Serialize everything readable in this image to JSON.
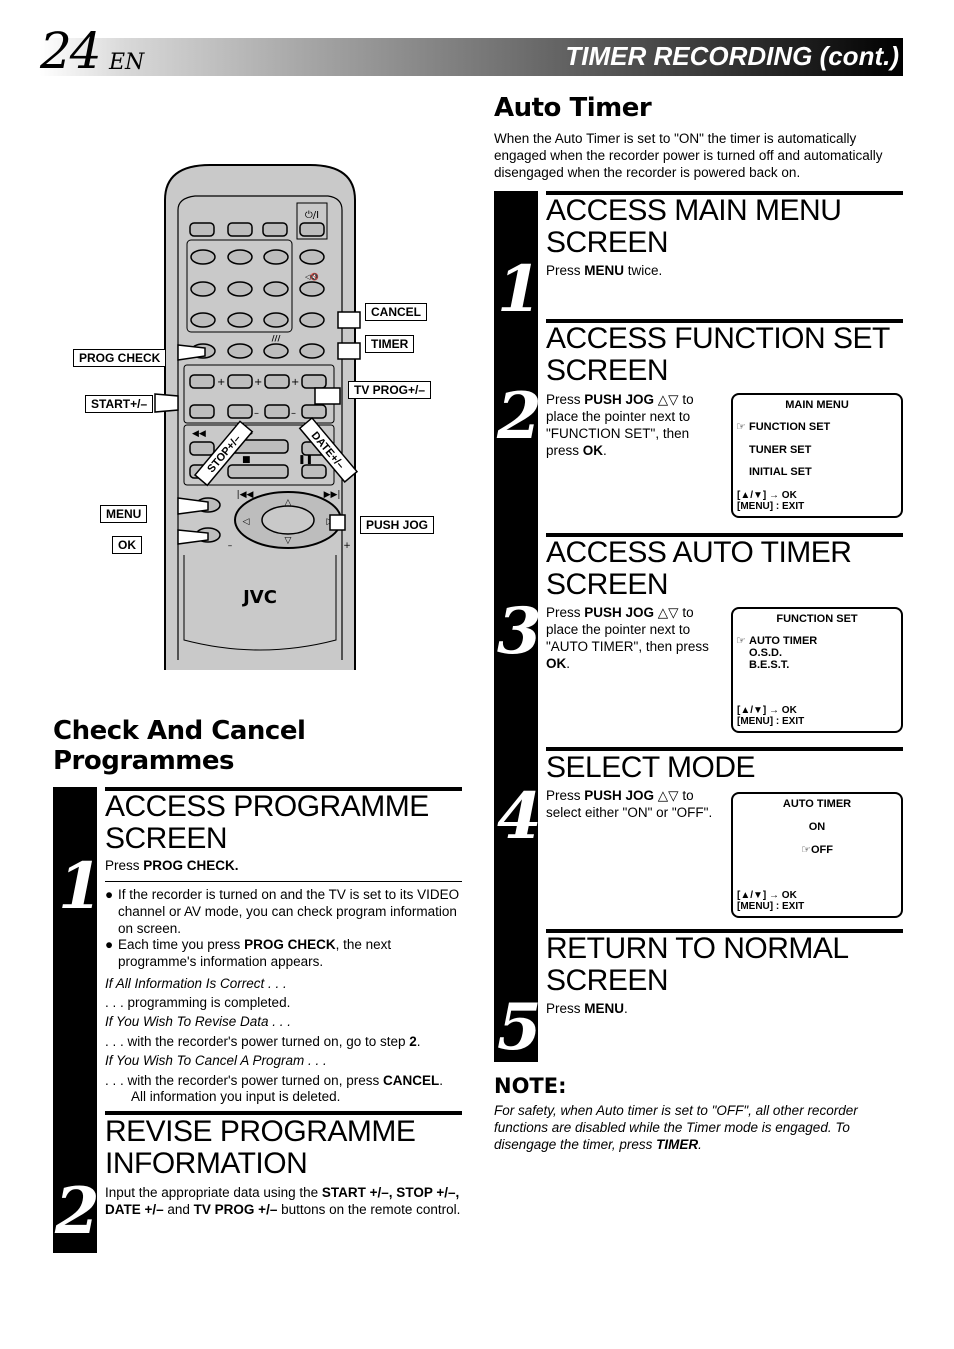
{
  "header": {
    "page_number": "24",
    "language": "EN",
    "title": "TIMER RECORDING (cont.)"
  },
  "remote": {
    "brand": "JVC",
    "callouts": {
      "cancel": "CANCEL",
      "timer": "TIMER",
      "prog_check": "PROG CHECK",
      "tv_prog": "TV PROG+/–",
      "start": "START+/–",
      "stop": "STOP+/–",
      "date": "DATE+/–",
      "menu": "MENU",
      "ok": "OK",
      "push_jog": "PUSH JOG"
    },
    "glyphs": {
      "power": "⏻/I",
      "plus": "+",
      "minus": "–"
    }
  },
  "check_cancel": {
    "heading_line1": "Check And Cancel",
    "heading_line2": "Programmes",
    "steps": [
      {
        "number": "1",
        "title_line1": "ACCESS PROGRAMME",
        "title_line2": "SCREEN",
        "instruction_prefix": "Press ",
        "instruction_bold": "PROG CHECK.",
        "bullets": [
          {
            "text": "If the recorder is turned on and the TV is set to its VIDEO channel or AV mode, you can check program information on screen."
          },
          {
            "pre": "Each time you press ",
            "bold": "PROG CHECK",
            "post": ", the next programme's information appears."
          }
        ],
        "cases": [
          {
            "condition": "If All Information Is Correct . . .",
            "result_pre": ". . . programming is completed.",
            "result_bold": "",
            "result_post": ""
          },
          {
            "condition": "If You Wish To Revise Data . . .",
            "result_pre": ". . . with the recorder's power turned on, go to step ",
            "result_bold": "2",
            "result_post": "."
          },
          {
            "condition": "If You Wish To Cancel A Program . . .",
            "result_pre": ". . . with the recorder's power turned on, press ",
            "result_bold": "CANCEL",
            "result_post": ".",
            "result_line2": "All information you input is deleted."
          }
        ]
      },
      {
        "number": "2",
        "title_line1": "REVISE PROGRAMME",
        "title_line2": "INFORMATION",
        "text_parts": [
          {
            "t": "Input the appropriate data using the ",
            "b": false
          },
          {
            "t": "START +/–, STOP +/–, DATE +/–",
            "b": true
          },
          {
            "t": " and ",
            "b": false
          },
          {
            "t": "TV PROG +/–",
            "b": true
          },
          {
            "t": " buttons on the remote control.",
            "b": false
          }
        ]
      }
    ]
  },
  "auto_timer": {
    "heading": "Auto Timer",
    "intro": "When the Auto Timer is set to \"ON\" the timer is automatically engaged when the recorder power is turned off and automatically disengaged when the recorder is powered back on.",
    "steps": [
      {
        "number": "1",
        "title_line1": "ACCESS MAIN MENU",
        "title_line2": "SCREEN",
        "parts": [
          {
            "t": "Press ",
            "b": false
          },
          {
            "t": "MENU",
            "b": true
          },
          {
            "t": " twice.",
            "b": false
          }
        ]
      },
      {
        "number": "2",
        "title_line1": "ACCESS FUNCTION SET",
        "title_line2": "SCREEN",
        "parts": [
          {
            "t": "Press ",
            "b": false
          },
          {
            "t": "PUSH JOG",
            "b": true
          },
          {
            "t": " △▽ to place the pointer next to \"FUNCTION SET\", then press ",
            "b": false
          },
          {
            "t": "OK",
            "b": true
          },
          {
            "t": ".",
            "b": false
          }
        ],
        "osd": {
          "title": "MAIN MENU",
          "items": [
            "FUNCTION SET",
            "TUNER SET",
            "INITIAL SET"
          ],
          "selected": "FUNCTION SET",
          "footer1": "[▲/▼] → OK",
          "footer2": "[MENU] : EXIT"
        }
      },
      {
        "number": "3",
        "title_line1": "ACCESS AUTO TIMER",
        "title_line2": "SCREEN",
        "parts": [
          {
            "t": "Press ",
            "b": false
          },
          {
            "t": "PUSH JOG",
            "b": true
          },
          {
            "t": " △▽ to place the pointer next to \"AUTO TIMER\", then press ",
            "b": false
          },
          {
            "t": "OK",
            "b": true
          },
          {
            "t": ".",
            "b": false
          }
        ],
        "osd": {
          "title": "FUNCTION SET",
          "items": [
            "AUTO TIMER",
            "O.S.D.",
            "B.E.S.T."
          ],
          "selected": "AUTO TIMER",
          "footer1": "[▲/▼] → OK",
          "footer2": "[MENU] : EXIT"
        }
      },
      {
        "number": "4",
        "title_line1": "SELECT MODE",
        "title_line2": "",
        "parts": [
          {
            "t": "Press ",
            "b": false
          },
          {
            "t": "PUSH JOG",
            "b": true
          },
          {
            "t": " △▽ to select either \"ON\" or \"OFF\".",
            "b": false
          }
        ],
        "osd": {
          "title": "AUTO TIMER",
          "items": [
            "ON",
            "OFF"
          ],
          "selected": "OFF",
          "footer1": "[▲/▼] → OK",
          "footer2": "[MENU] : EXIT"
        }
      },
      {
        "number": "5",
        "title_line1": "RETURN TO NORMAL",
        "title_line2": "SCREEN",
        "parts": [
          {
            "t": "Press ",
            "b": false
          },
          {
            "t": "MENU",
            "b": true
          },
          {
            "t": ".",
            "b": false
          }
        ]
      }
    ]
  },
  "note": {
    "heading": "NOTE:",
    "pre": "For safety, when Auto timer is set to \"OFF\", all other recorder functions are disabled while the Timer mode is engaged. To disengage the timer, press ",
    "bold": "TIMER",
    "post": "."
  },
  "osd_pointer_icon": "☞"
}
